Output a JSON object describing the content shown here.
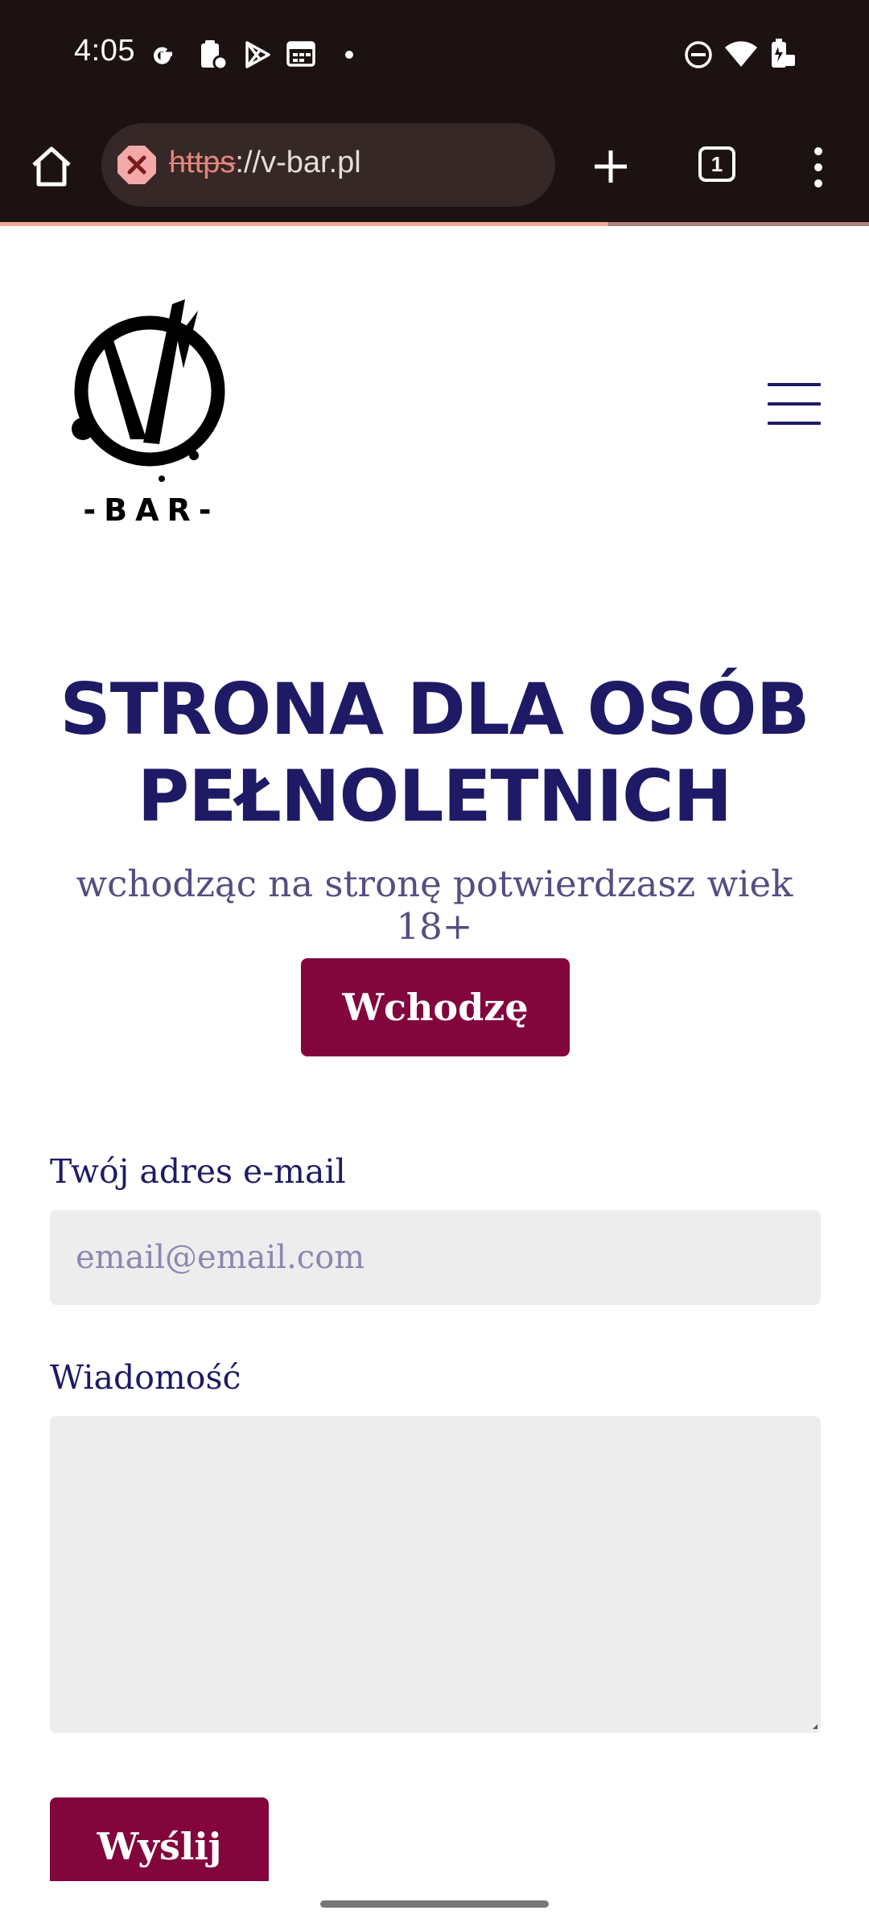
{
  "status_bar": {
    "time": "4:05",
    "left_icons": [
      "google-icon",
      "clipboard-icon",
      "play-store-icon",
      "calendar-icon",
      "dot-icon"
    ],
    "right_icons": [
      "do-not-disturb-icon",
      "wifi-icon",
      "battery-icon"
    ]
  },
  "browser": {
    "url_scheme": "https",
    "url_rest": "://v-bar.pl",
    "security_state": "not-secure",
    "tab_count": "1",
    "load_progress": 0.7,
    "colors": {
      "toolbar": "#1c1212",
      "urlbar": "#352826",
      "warning": "#e6857a"
    }
  },
  "page": {
    "logo_text": "-BAR-",
    "headline": "STRONA DLA OSÓB PEŁNOLETNICH",
    "subline": "wchodząc na stronę potwierdzasz wiek 18+",
    "enter_button": "Wchodzę",
    "email_label": "Twój adres e-mail",
    "email_placeholder": "email@email.com",
    "message_label": "Wiadomość",
    "send_button": "Wyślij",
    "colors": {
      "primary": "#1f1a66",
      "accent": "#82053c",
      "field_bg": "#ededed"
    }
  }
}
